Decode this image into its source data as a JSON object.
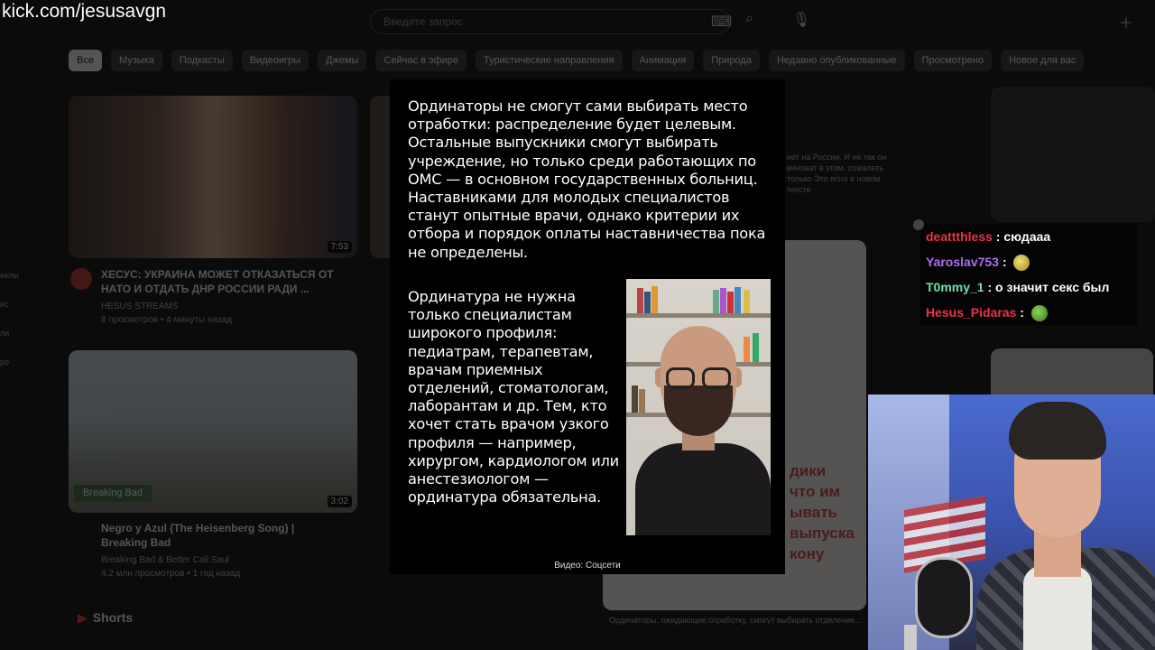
{
  "watermark": "kick.com/jesusavgn",
  "youtube": {
    "search_placeholder": "Введите запрос",
    "chips": [
      "Все",
      "Музыка",
      "Подкасты",
      "Видеоигры",
      "Джемы",
      "Сейчас в эфире",
      "Туристические направления",
      "Анимация",
      "Природа",
      "Недавно опубликованные",
      "Просмотрено",
      "Новое для вас"
    ],
    "sidebar": [
      "еклы",
      "ис",
      "ли",
      "ро"
    ],
    "video1": {
      "title": "ХЕСУС: УКРАИНА МОЖЕТ ОТКАЗАТЬСЯ ОТ НАТО И ОТДАТЬ ДНР РОССИИ РАДИ ...",
      "channel": "HESUS STREAMS",
      "meta": "8 просмотров • 4 минуты назад",
      "duration": "7:53"
    },
    "video2": {
      "title": "Negro y Azul (The Heisenberg Song) | Breaking Bad",
      "channel": "Breaking Bad & Better Call Saul",
      "meta": "4,2 млн просмотров • 1 год назад",
      "duration": "3:02",
      "tag": "Breaking Bad"
    },
    "shorts_label": "Shorts",
    "red_text": [
      "дики",
      "что им",
      "ывать",
      "выпуска",
      "кону"
    ],
    "side_text": "нет на России. И не так он виноват в этом. сожалеть только Это ясно в новом тексте",
    "bottom_text": "Ординаторы, ожидающие отработку, смогут выбирать отделение..."
  },
  "panel": {
    "paragraph1": "Ординаторы не смогут сами выбирать место отработки: распределение будет целевым. Остальные выпускники смогут выбирать учреждение, но только среди работающих по ОМС — в основном государственных больниц. Наставниками для молодых специалистов станут опытные врачи, однако критерии их отбора и порядок оплаты наставничества пока не определены.",
    "paragraph2": "Ординатура не нужна только специалистам широкого профиля: педиатрам, терапевтам, врачам приемных отделений, стоматологам, лаборантам и др. Тем, кто хочет стать врачом узкого профиля — например, хирургом, кардиологом или анестезиологом — ординатура обязательна.",
    "caption": "Видео: Соцсети"
  },
  "chat": [
    {
      "user": "deattthless",
      "color": "#e8344a",
      "message": "сюдааа",
      "emote": ""
    },
    {
      "user": "Yaroslav753",
      "color": "#b06cf0",
      "message": "",
      "emote": "yellow"
    },
    {
      "user": "T0mmy_1",
      "color": "#6fe0a8",
      "message": "о значит секс был",
      "emote": ""
    },
    {
      "user": "Hesus_Pidaras",
      "color": "#e8344a",
      "message": "",
      "emote": "pepe"
    }
  ],
  "icons": {
    "search": "search-icon",
    "mic": "mic-icon",
    "create": "create-icon"
  }
}
